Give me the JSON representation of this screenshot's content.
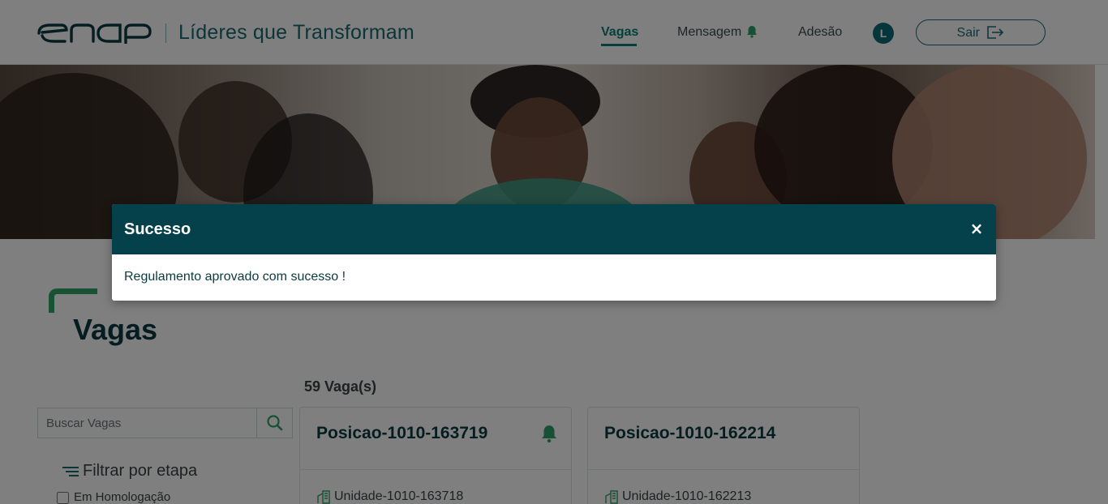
{
  "header": {
    "brand_title": "Líderes que Transformam",
    "nav": [
      {
        "label": "Vagas",
        "active": true
      },
      {
        "label": "Mensagem"
      },
      {
        "label": "Adesão"
      }
    ],
    "avatar_initial": "L",
    "logout_label": "Sair",
    "accent_color": "#0a8078"
  },
  "main": {
    "page_title": "Vagas",
    "count_label": "59 Vaga(s)",
    "search": {
      "placeholder": "Buscar Vagas",
      "value": ""
    },
    "filter": {
      "title": "Filtrar por etapa",
      "options": [
        {
          "label": "Em Homologação",
          "checked": false
        }
      ]
    },
    "cards": [
      {
        "title": "Posicao-1010-163719",
        "unit": "Unidade-1010-163718",
        "has_bell": true
      },
      {
        "title": "Posicao-1010-162214",
        "unit": "Unidade-1010-162213",
        "has_bell": false
      }
    ]
  },
  "modal": {
    "title": "Sucesso",
    "close_label": "×",
    "message": "Regulamento aprovado com sucesso !",
    "header_color": "#04414a"
  }
}
